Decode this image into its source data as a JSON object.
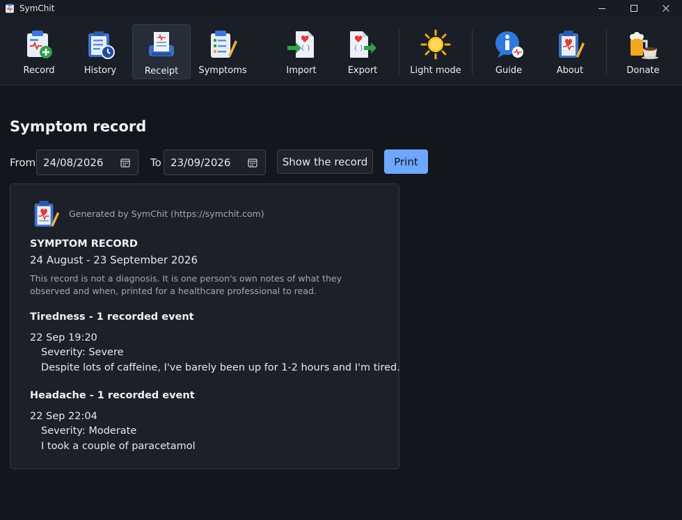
{
  "window": {
    "title": "SymChit",
    "controls": [
      "minimize-icon",
      "maximize-icon",
      "close-icon"
    ]
  },
  "toolbar": {
    "items": [
      {
        "label": "Record",
        "icon": "clipboard-add-icon",
        "active": false
      },
      {
        "label": "History",
        "icon": "clipboard-clock-icon",
        "active": false
      },
      {
        "label": "Receipt",
        "icon": "receipt-printer-icon",
        "active": true
      },
      {
        "label": "Symptoms",
        "icon": "checklist-pencil-icon",
        "active": false
      },
      {
        "label": "Import",
        "icon": "import-file-icon",
        "active": false
      },
      {
        "label": "Export",
        "icon": "export-file-icon",
        "active": false
      },
      {
        "label": "Light mode",
        "icon": "sun-icon",
        "active": false
      },
      {
        "label": "Guide",
        "icon": "info-bubble-icon",
        "active": false
      },
      {
        "label": "About",
        "icon": "clipboard-heart-icon",
        "active": false
      },
      {
        "label": "Donate",
        "icon": "beer-coffee-icon",
        "active": false
      }
    ]
  },
  "main": {
    "title": "Symptom record",
    "filter": {
      "from_label": "From",
      "from_value": "24/08/2026",
      "to_label": "To",
      "to_value": "23/09/2026",
      "show_button": "Show the record",
      "print_button": "Print"
    }
  },
  "record": {
    "generated_by": "Generated by SymChit (https://symchit.com)",
    "title": "SYMPTOM RECORD",
    "date_range": "24 August - 23 September 2026",
    "disclaimer": "This record is not a diagnosis. It is one person's own notes of what they observed and when, printed for a healthcare professional to read.",
    "sections": [
      {
        "heading": "Tiredness - 1 recorded event",
        "events": [
          {
            "datetime": "22 Sep 19:20",
            "severity": "Severity: Severe",
            "note": "Despite lots of caffeine, I've barely been up for 1-2 hours and I'm tired."
          }
        ]
      },
      {
        "heading": "Headache - 1 recorded event",
        "events": [
          {
            "datetime": "22 Sep 22:04",
            "severity": "Severity: Moderate",
            "note": "I took a couple of paracetamol"
          }
        ]
      }
    ]
  },
  "colors": {
    "background": "#13161c",
    "toolbar": "#1a1e26",
    "accent": "#6fa6ff",
    "card": "#1d2028"
  }
}
